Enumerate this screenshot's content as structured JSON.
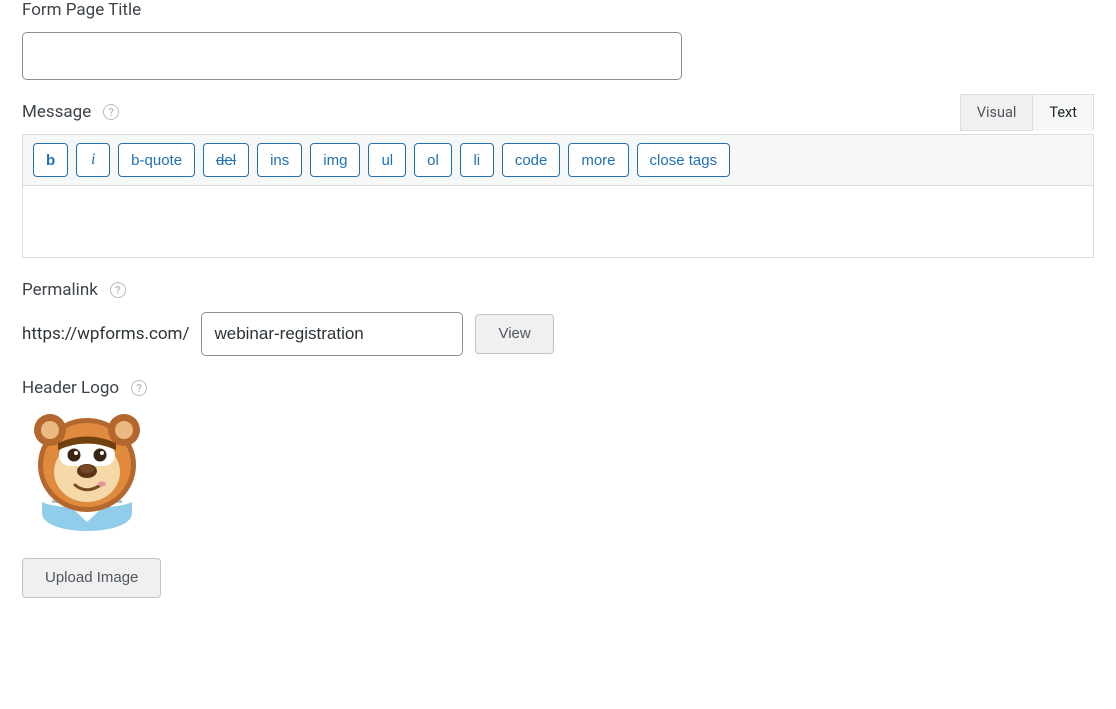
{
  "title_field": {
    "label": "Form Page Title",
    "value": ""
  },
  "message_field": {
    "label": "Message",
    "tabs": {
      "visual": "Visual",
      "text": "Text",
      "active": "text"
    },
    "quicktags": [
      "b",
      "i",
      "b-quote",
      "del",
      "ins",
      "img",
      "ul",
      "ol",
      "li",
      "code",
      "more",
      "close tags"
    ],
    "value": ""
  },
  "permalink_field": {
    "label": "Permalink",
    "base_url": "https://wpforms.com/",
    "slug": "webinar-registration",
    "view_label": "View"
  },
  "logo_field": {
    "label": "Header Logo",
    "upload_label": "Upload Image"
  }
}
